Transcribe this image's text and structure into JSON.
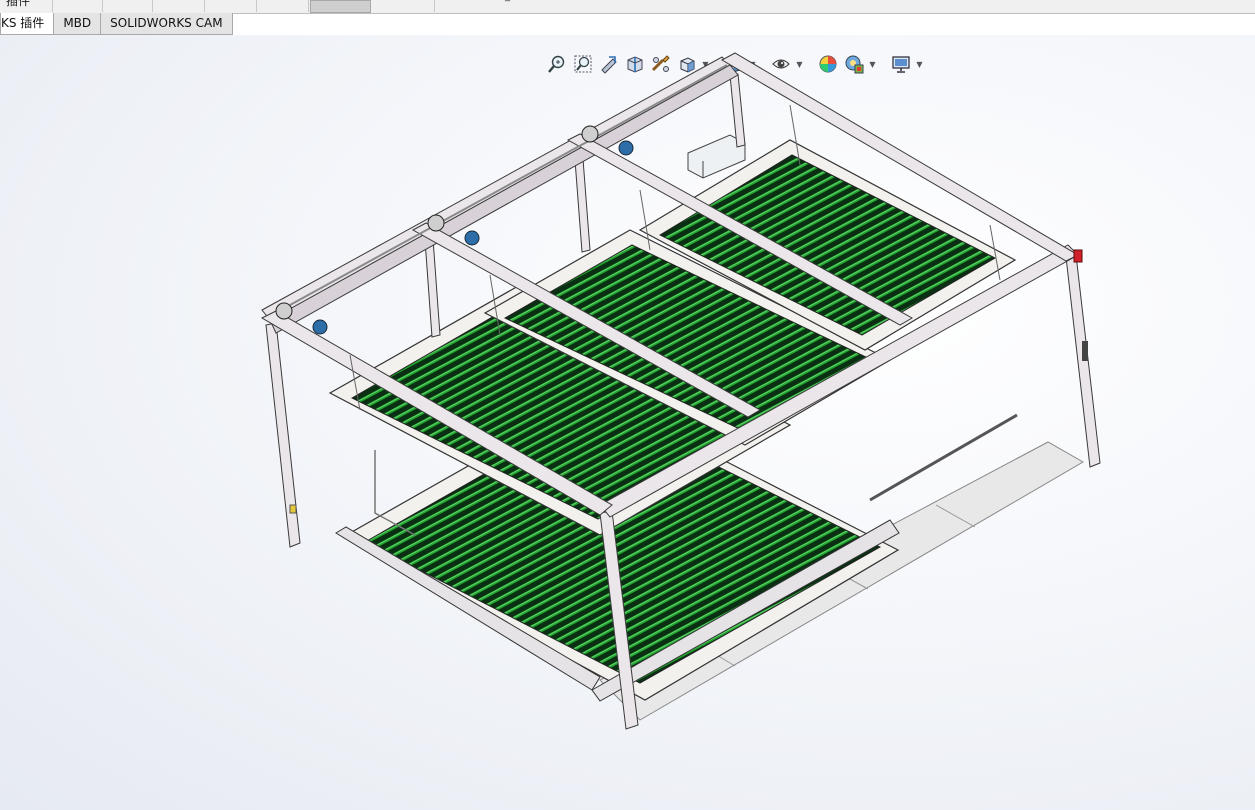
{
  "app": {
    "top_strip": {
      "partial_label": "插件"
    },
    "tabs": [
      {
        "id": "addins",
        "label": "KS 插件",
        "active": true
      },
      {
        "id": "mbd",
        "label": "MBD",
        "active": false
      },
      {
        "id": "cam",
        "label": "SOLIDWORKS CAM",
        "active": false
      }
    ]
  },
  "heads_up_toolbar": [
    "zoom-to-fit-icon",
    "zoom-to-area-icon",
    "previous-view-icon",
    "section-view-icon",
    "dynamic-annotation-views-icon",
    "view-orientation-icon",
    "display-style-icon",
    "hide-show-items-icon",
    "edit-appearance-icon",
    "apply-scene-icon",
    "view-settings-icon"
  ],
  "model": {
    "description_visible": false,
    "colors": {
      "frame": "#ebe6ea",
      "frame_edge": "#3a3a3a",
      "slat_green": "#1fa32d",
      "slat_dark": "#0b2f12",
      "plate": "#f3f1ee",
      "ramp": "#e8e8e8",
      "motor": "#2d6ea8",
      "indicator": "#d0202a"
    }
  }
}
